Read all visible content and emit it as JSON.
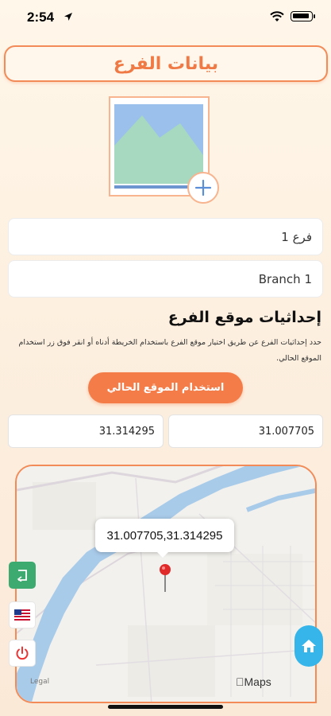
{
  "status_bar": {
    "time": "2:54"
  },
  "header": {
    "title": "بيانات الفرع"
  },
  "image_picker": {
    "icon": "image-placeholder-icon",
    "add_icon": "plus-icon"
  },
  "form": {
    "name_ar": "فرع 1",
    "name_en": "Branch 1"
  },
  "location": {
    "title": "إحداثيات موقع الفرع",
    "description": "حدد إحداثيات الفرع عن طريق اختيار موقع الفرع باستخدام الخريطة أدناه أو انقر فوق زر استخدام الموقع الحالي.",
    "use_current_label": "استخدام الموقع الحالي",
    "longitude": "31.314295",
    "latitude": "31.007705"
  },
  "map": {
    "callout": "31.007705,31.314295",
    "provider": "Maps",
    "legal": "Legal"
  },
  "colors": {
    "accent": "#f47c48",
    "green": "#3daa6f",
    "home": "#35b5e9"
  }
}
